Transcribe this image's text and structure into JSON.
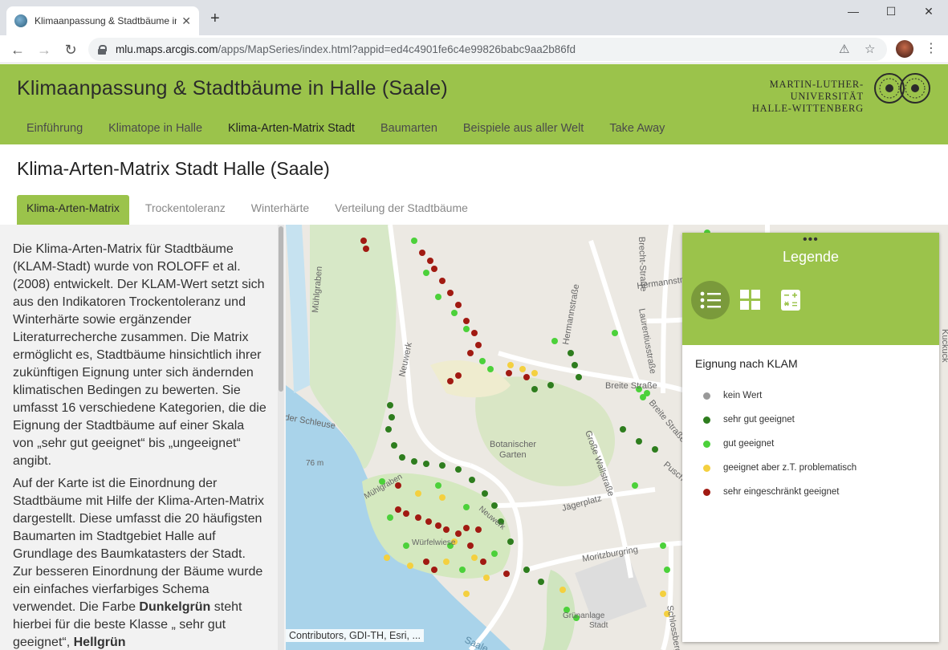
{
  "browser": {
    "tab_title": "Klimaanpassung & Stadtbäume in",
    "url_host": "mlu.maps.arcgis.com",
    "url_rest": "/apps/MapSeries/index.html?appid=ed4c4901fe6c4e99826babc9aa2b86fd"
  },
  "header": {
    "title": "Klimaanpassung & Stadtbäume in Halle (Saale)",
    "uni_line1": "MARTIN-LUTHER-UNIVERSITÄT",
    "uni_line2": "HALLE-WITTENBERG",
    "nav": [
      "Einführung",
      "Klimatope in Halle",
      "Klima-Arten-Matrix Stadt",
      "Baumarten",
      "Beispiele aus aller Welt",
      "Take Away"
    ],
    "active_nav": "Klima-Arten-Matrix Stadt"
  },
  "page": {
    "title": "Klima-Arten-Matrix Stadt Halle (Saale)",
    "subtabs": [
      "Klima-Arten-Matrix",
      "Trockentoleranz",
      "Winterhärte",
      "Verteilung der Stadtbäume"
    ],
    "active_subtab": "Klima-Arten-Matrix"
  },
  "narrative": {
    "p1": "Die Klima-Arten-Matrix für Stadtbäume (KLAM-Stadt) wurde von ROLOFF et al. (2008) entwickelt. Der KLAM-Wert setzt sich aus den Indikatoren Trockentoleranz und Winterhärte sowie ergänzender Literaturrecherche zusammen. Die Matrix ermöglicht es, Stadtbäume hinsichtlich ihrer zukünftigen Eignung unter sich ändernden klimatischen Bedingen zu bewerten. Sie umfasst 16 verschiedene Kategorien, die die Eignung der Stadtbäume auf einer Skala von „sehr gut geeignet“ bis „ungeeignet“ angibt.",
    "p2_a": "Auf der Karte ist die Einordnung der Stadtbäume mit Hilfe der Klima-Arten-Matrix dargestellt. Diese umfasst die 20 häufigsten Baumarten im Stadtgebiet Halle auf Grundlage des Baumkatasters der Stadt. Zur besseren Einordnung der Bäume wurde ein einfaches vierfarbiges Schema verwendet. Die Farbe ",
    "p2_b1": "Dunkelgrün",
    "p2_c": " steht hierbei für die beste Klasse „ sehr gut geeignet“, ",
    "p2_b2": "Hellgrün"
  },
  "map": {
    "labels": {
      "muehlgraben": "Mühlgraben",
      "neuwerk": "Neuwerk",
      "schleuse": "der Schleuse",
      "elev": "76 m",
      "garten1": "Botanischer",
      "garten2": "Garten",
      "breite1": "Breite Straße",
      "breite2": "Breite Straße",
      "hermann": "Hermannstraße",
      "laurent": "Laurentiusstraße",
      "wall": "Große Wallstraße",
      "jaeger": "Jägerplatz",
      "moritz": "Moritzburgring",
      "wurfel": "Würfelwiese",
      "anlage1": "Grünanlage",
      "anlage2": "Stadt",
      "neuwerk2": "Neuwerk",
      "muehl2": "Mühlgraben",
      "saale": "Saale",
      "hermannstr2": "Hermannstr",
      "echt": "Brecht-Straße",
      "puschkin": "Puschkinstr",
      "schloss": "Schlossberg",
      "kuck": "Kuckuck"
    },
    "attribution": "Contributors, GDI-TH, Esri, ..."
  },
  "legend": {
    "title": "Legende",
    "heading": "Eignung nach KLAM",
    "items": [
      {
        "label": "kein Wert",
        "color": "#999999"
      },
      {
        "label": "sehr gut geeignet",
        "color": "#2e7d1e"
      },
      {
        "label": "gut geeignet",
        "color": "#4cd13a"
      },
      {
        "label": "geeignet aber z.T. problematisch",
        "color": "#f4d03f"
      },
      {
        "label": "sehr eingeschränkt geeignet",
        "color": "#a11a12"
      }
    ]
  }
}
